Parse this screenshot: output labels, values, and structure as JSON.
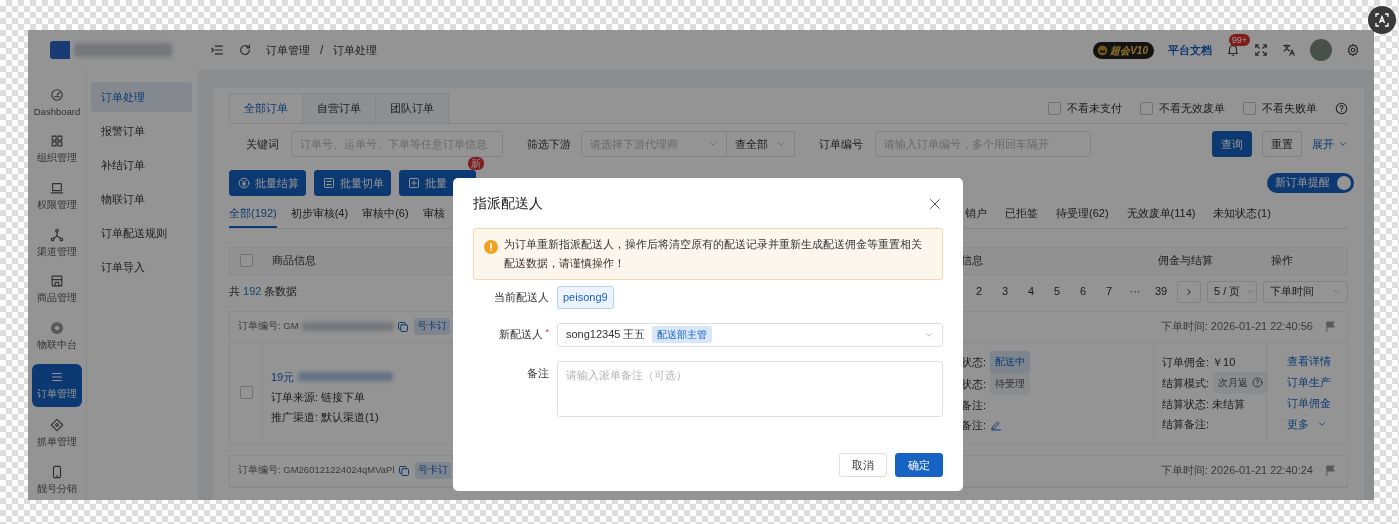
{
  "header": {
    "breadcrumb": [
      "订单管理",
      "订单处理"
    ],
    "breadcrumb_separator": "/",
    "vip_badge": "超会V10",
    "docs_link": "平台文档",
    "notification_count": "99+"
  },
  "nav_rail": [
    {
      "label": "Dashboard",
      "kind": "gauge",
      "selected": false
    },
    {
      "label": "组织管理",
      "kind": "grid",
      "selected": false
    },
    {
      "label": "权限管理",
      "kind": "laptop",
      "selected": false
    },
    {
      "label": "渠道管理",
      "kind": "nodes",
      "selected": false
    },
    {
      "label": "商品管理",
      "kind": "store",
      "selected": false
    },
    {
      "label": "物联中台",
      "kind": "cube",
      "selected": false
    },
    {
      "label": "订单管理",
      "kind": "list",
      "selected": true
    },
    {
      "label": "抓单管理",
      "kind": "target",
      "selected": false
    },
    {
      "label": "靓号分销",
      "kind": "phone",
      "selected": false
    }
  ],
  "submenu": [
    {
      "label": "订单处理",
      "selected": true
    },
    {
      "label": "报警订单",
      "selected": false
    },
    {
      "label": "补结订单",
      "selected": false
    },
    {
      "label": "物联订单",
      "selected": false
    },
    {
      "label": "订单配送规则",
      "selected": false
    },
    {
      "label": "订单导入",
      "selected": false
    }
  ],
  "order_tabs": [
    {
      "label": "全部订单",
      "selected": true
    },
    {
      "label": "自营订单",
      "selected": false
    },
    {
      "label": "团队订单",
      "selected": false
    }
  ],
  "view_toggles": [
    {
      "label": "不看未支付",
      "checked": false
    },
    {
      "label": "不看无效废单",
      "checked": false
    },
    {
      "label": "不看失败单",
      "checked": false
    }
  ],
  "filters": {
    "keyword_label": "关键词",
    "keyword_placeholder": "订单号、运单号、下单等任意订单信息",
    "downstream_label": "筛选下游",
    "downstream_placeholder": "请选择下游代理商",
    "scope_value": "查全部",
    "order_no_label": "订单编号",
    "order_no_placeholder": "请输入订单编号，多个用回车隔开",
    "search_button": "查询",
    "reset_button": "重置",
    "expand_link": "展开"
  },
  "batch_buttons": [
    {
      "label": "批量结算",
      "kind": "yen"
    },
    {
      "label": "批量切单",
      "kind": "swap"
    },
    {
      "label": "批量",
      "kind": "plus",
      "badge": "新"
    }
  ],
  "new_order_alert": {
    "label": "新订单提醒",
    "on": true
  },
  "status_tabs": [
    {
      "label": "全部(192)",
      "selected": true
    },
    {
      "label": "初步审核(4)",
      "selected": false
    },
    {
      "label": "审核中(6)",
      "selected": false
    },
    {
      "label": "审核",
      "selected": false
    }
  ],
  "status_tabs_right": [
    {
      "label": "销户",
      "selected": false
    },
    {
      "label": "已拒签",
      "selected": false
    },
    {
      "label": "待受理(62)",
      "selected": false
    },
    {
      "label": "无效废单(114)",
      "selected": false
    },
    {
      "label": "未知状态(1)",
      "selected": false
    }
  ],
  "table": {
    "select_all_checked": false,
    "columns": [
      "商品信息",
      "信息",
      "佣金与结算",
      "操作"
    ],
    "total_prefix": "共",
    "total_count": "192",
    "total_suffix": "条数据"
  },
  "pagination": {
    "pages": [
      "2",
      "3",
      "4",
      "5",
      "6",
      "7",
      "···",
      "39"
    ],
    "page_size": "5 / 页",
    "sort": "下单时间"
  },
  "orders": [
    {
      "order_no": "订单编号: GM",
      "order_no_blurred": true,
      "tag": "号卡订",
      "time": "下单时间: 2026-01-21 22:40:56",
      "checked": false,
      "product": "19元",
      "product_blurred": true,
      "source": "订单来源: 链接下单",
      "channel": "推广渠道: 默认渠道(1)",
      "info_lines": [
        {
          "label": "状态:",
          "tag": "配送中",
          "kind": "blue"
        },
        {
          "label": "状态:",
          "tag": "待受理",
          "kind": "grey"
        },
        {
          "label": "备注:",
          "kind": "plain"
        },
        {
          "label": "备注:",
          "kind": "edit"
        }
      ],
      "commission_lines": [
        {
          "label": "订单佣金: ￥10",
          "kind": "plain"
        },
        {
          "label": "结算模式:",
          "tag": "次月返",
          "kind": "help"
        },
        {
          "label": "结算状态: 未结算",
          "kind": "plain"
        },
        {
          "label": "结算备注:",
          "kind": "plain"
        }
      ],
      "actions": [
        "查看详情",
        "订单生产",
        "订单佣金"
      ],
      "more": "更多"
    },
    {
      "order_no": "订单编号: GM260121224024qMVaPl",
      "tag": "号卡订",
      "time": "下单时间: 2026-01-21 22:40:24"
    }
  ],
  "modal": {
    "title": "指派配送人",
    "alert": "为订单重新指派配送人，操作后将清空原有的配送记录并重新生成配送佣金等重置相关配送数据，请谨慎操作！",
    "fields": [
      {
        "kind": "tag",
        "label": "当前配送人",
        "value": "peisong9"
      },
      {
        "kind": "select",
        "label": "新配送人",
        "required_mark": "*",
        "value": "song12345 王五",
        "tag": "配送部主管"
      },
      {
        "kind": "textarea",
        "label": "备注",
        "placeholder": "请输入派单备注（可选）"
      }
    ],
    "buttons": [
      {
        "label": "取消",
        "kind": "secondary"
      },
      {
        "label": "确定",
        "kind": "primary"
      }
    ]
  }
}
